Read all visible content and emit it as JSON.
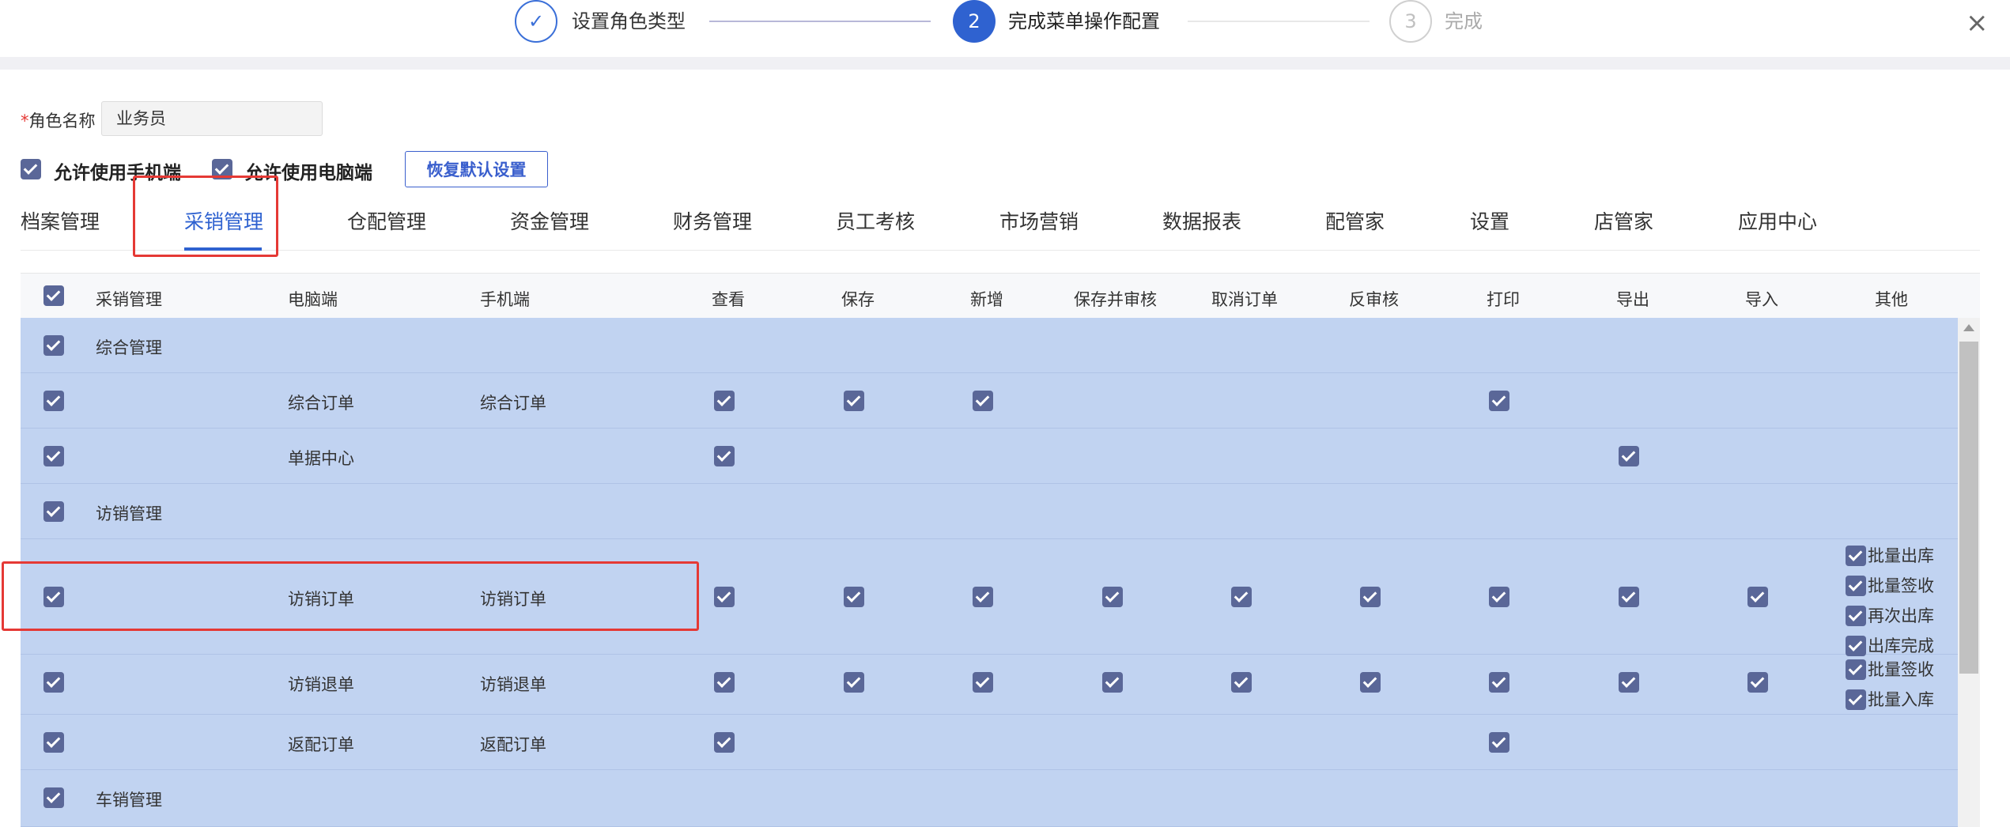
{
  "steps": [
    {
      "num": "✓",
      "label": "设置角色类型",
      "state": "done"
    },
    {
      "num": "2",
      "label": "完成菜单操作配置",
      "state": "active"
    },
    {
      "num": "3",
      "label": "完成",
      "state": "todo"
    }
  ],
  "close_icon": "×",
  "role": {
    "label": "角色名称",
    "required_mark": "*",
    "value": "业务员"
  },
  "permissions": {
    "mobile": "允许使用手机端",
    "pc": "允许使用电脑端",
    "restore_button": "恢复默认设置"
  },
  "tabs": [
    "档案管理",
    "采销管理",
    "仓配管理",
    "资金管理",
    "财务管理",
    "员工考核",
    "市场营销",
    "数据报表",
    "配管家",
    "设置",
    "店管家",
    "应用中心"
  ],
  "active_tab": "采销管理",
  "table": {
    "headers": [
      "采销管理",
      "电脑端",
      "手机端",
      "查看",
      "保存",
      "新增",
      "保存并审核",
      "取消订单",
      "反审核",
      "打印",
      "导出",
      "导入",
      "其他"
    ],
    "rows": [
      {
        "group": "综合管理",
        "pc": "",
        "mobile": ""
      },
      {
        "group": "",
        "pc": "综合订单",
        "mobile": "综合订单"
      },
      {
        "group": "",
        "pc": "单据中心",
        "mobile": ""
      },
      {
        "group": "访销管理",
        "pc": "",
        "mobile": ""
      },
      {
        "group": "",
        "pc": "访销订单",
        "mobile": "访销订单",
        "other": [
          "批量出库",
          "批量签收",
          "再次出库",
          "出库完成"
        ]
      },
      {
        "group": "",
        "pc": "访销退单",
        "mobile": "访销退单",
        "other": [
          "批量签收",
          "批量入库"
        ]
      },
      {
        "group": "",
        "pc": "返配订单",
        "mobile": "返配订单"
      },
      {
        "group": "车销管理",
        "pc": "",
        "mobile": ""
      }
    ]
  },
  "colors": {
    "accent": "#2f62d0",
    "checkbox": "#5a6798",
    "row_bg": "#c1d3f1",
    "highlight": "#e53935"
  }
}
